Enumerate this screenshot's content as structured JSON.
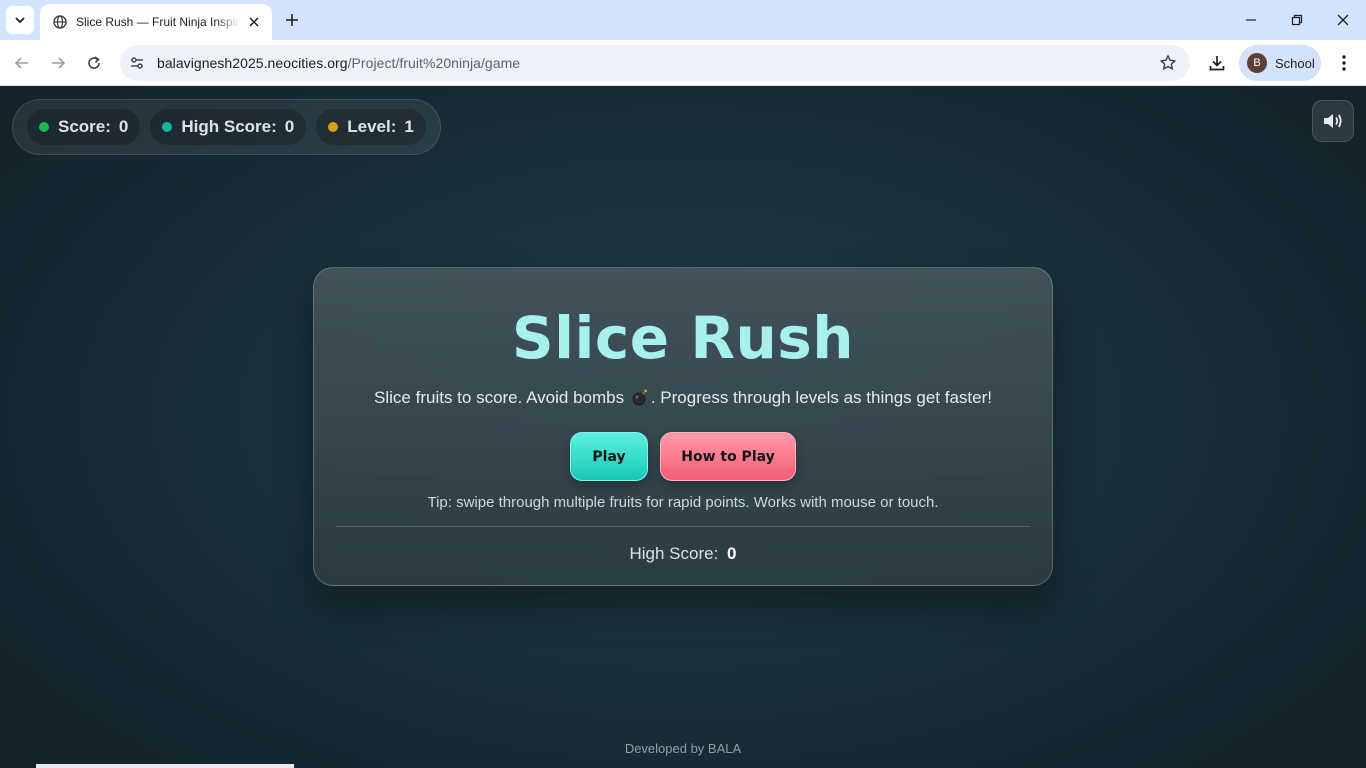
{
  "browser": {
    "tab_title": "Slice Rush — Fruit Ninja Inspired",
    "url_host": "balavignesh2025.neocities.org",
    "url_path": "/Project/fruit%20ninja/game",
    "profile_initial": "B",
    "profile_name": "School"
  },
  "hud": {
    "score_label": "Score:",
    "score_value": "0",
    "high_score_label": "High Score:",
    "high_score_value": "0",
    "level_label": "Level:",
    "level_value": "1",
    "colors": {
      "score": "#1db954",
      "high_score": "#17b2a2",
      "level": "#d4a017"
    }
  },
  "menu": {
    "title": "Slice Rush",
    "subtitle_before": "Slice fruits to score. Avoid bombs",
    "subtitle_after": ". Progress through levels as things get faster!",
    "bomb_icon": "bomb-icon",
    "play_label": "Play",
    "how_label": "How to Play",
    "tip": "Tip: swipe through multiple fruits for rapid points. Works with mouse or touch.",
    "high_score_label": "High Score:",
    "high_score_value": "0"
  },
  "footer": {
    "text": "Developed by BALA"
  },
  "icons": {
    "sound": "speaker-icon",
    "favicon": "globe-icon"
  }
}
